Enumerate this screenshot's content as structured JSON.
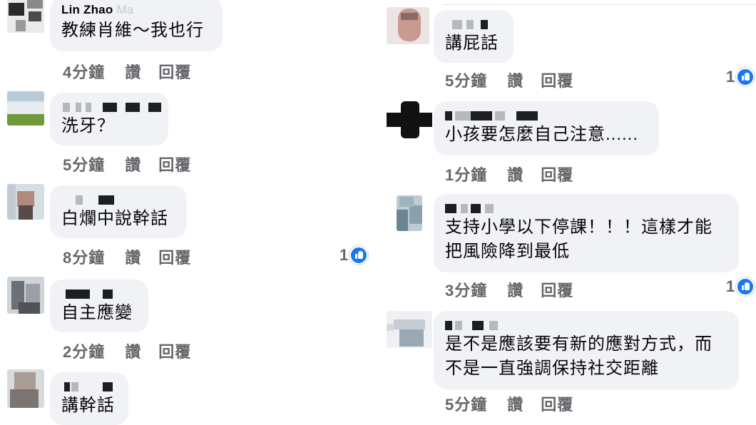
{
  "actions": {
    "like_label": "讚",
    "reply_label": "回覆"
  },
  "left_comments": [
    {
      "author": "Lin Zhao",
      "author_suffix": "Ma",
      "text": "教練肖維～我也行",
      "time": "4分鐘",
      "reactions": ""
    },
    {
      "author": "",
      "text": "洗牙？",
      "time": "5分鐘",
      "reactions": ""
    },
    {
      "author": "",
      "text": "白爛中說幹話",
      "time": "8分鐘",
      "reactions": "1"
    },
    {
      "author": "",
      "text": "自主應變",
      "time": "2分鐘",
      "reactions": ""
    },
    {
      "author": "",
      "text": "講幹話",
      "time": "",
      "reactions": ""
    }
  ],
  "right_comments": [
    {
      "author": "",
      "text": "講屁話",
      "time": "5分鐘",
      "reactions": "1"
    },
    {
      "author": "",
      "text": "小孩要怎麼自己注意......",
      "time": "1分鐘",
      "reactions": ""
    },
    {
      "author": "",
      "text_line1": "支持小學以下停課！！！這樣才能",
      "text_line2": "把風險降到最低",
      "time": "3分鐘",
      "reactions": "1"
    },
    {
      "author": "",
      "text_line1": "是不是應該要有新的應對方式，而",
      "text_line2": "不是一直強調保持社交距離",
      "time": "5分鐘",
      "reactions": ""
    }
  ],
  "colors": {
    "bubble": "#f0f2f5",
    "meta": "#65676b",
    "like_blue": "#1877f2"
  }
}
